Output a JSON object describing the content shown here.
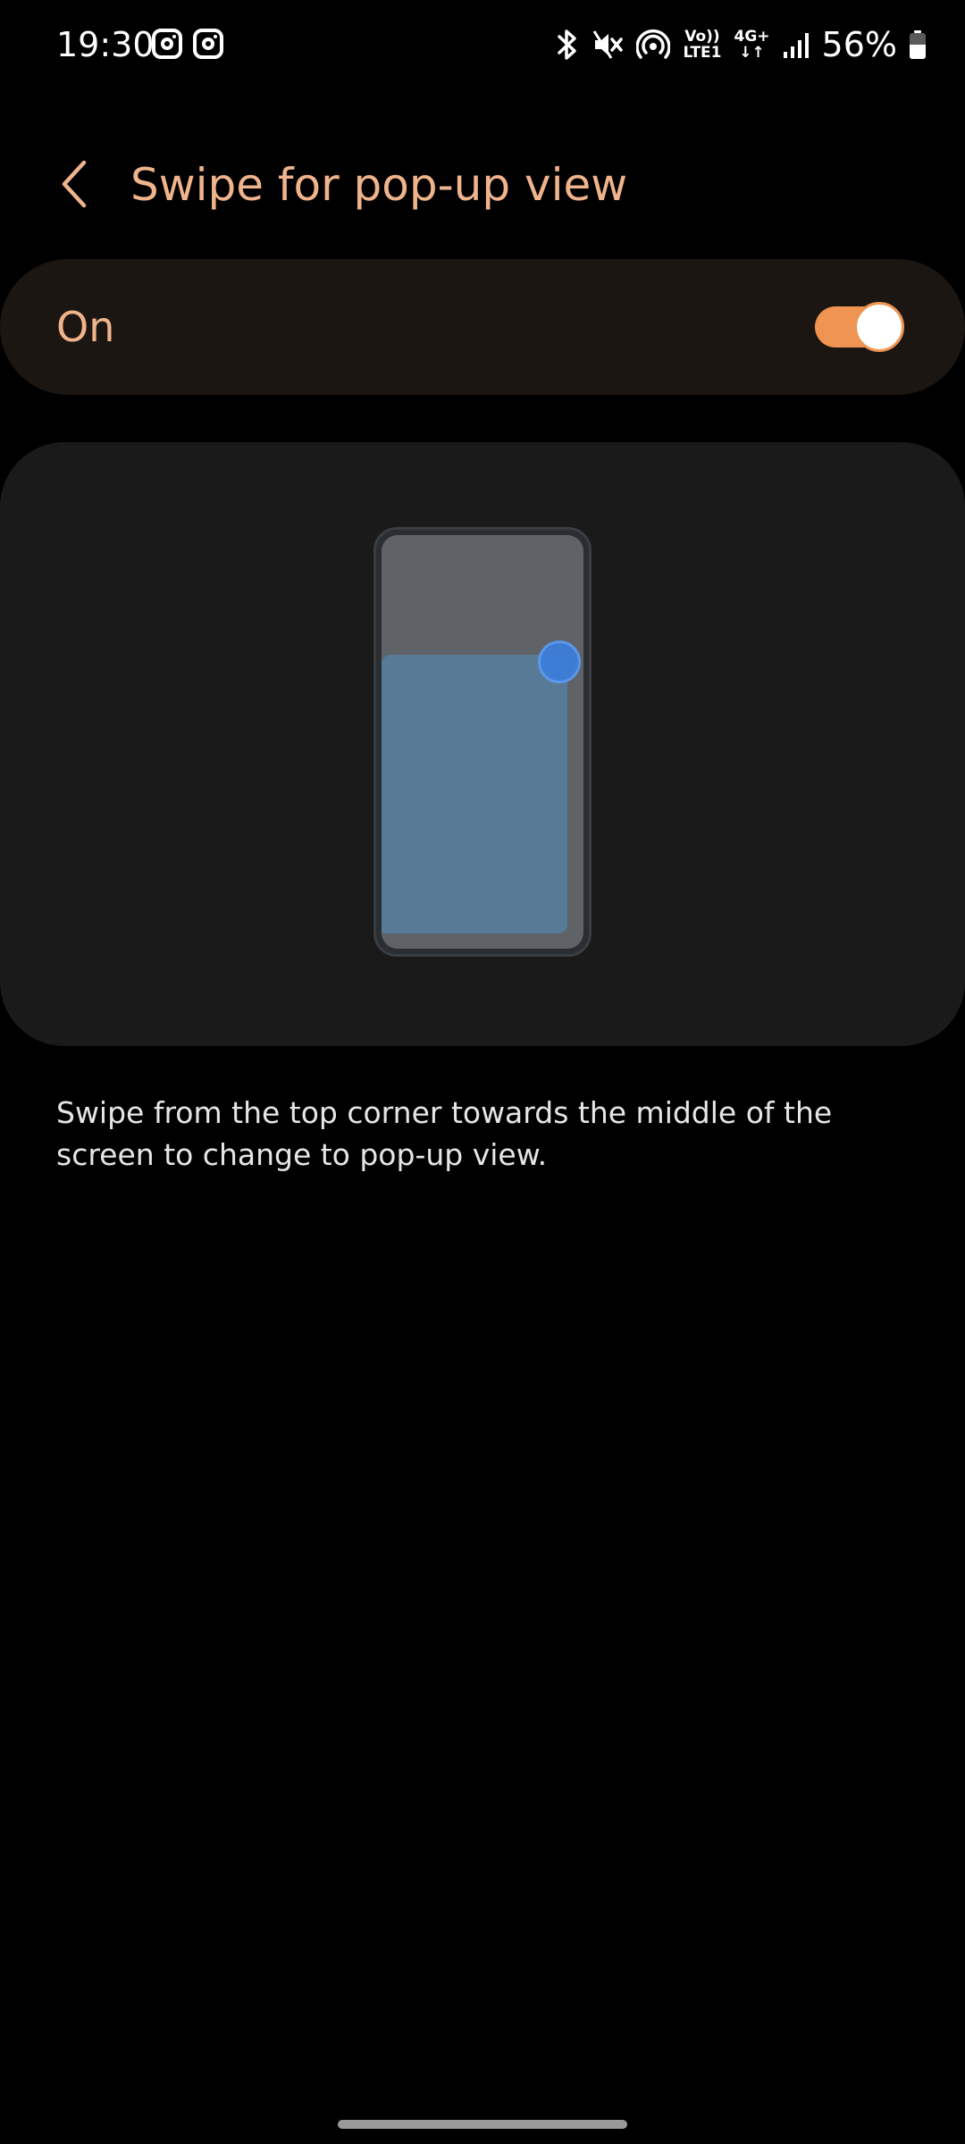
{
  "status_bar": {
    "time": "19:30",
    "left_icons": [
      "instagram-icon",
      "instagram-icon"
    ],
    "right_icons": [
      "bluetooth-icon",
      "mute-icon",
      "hotspot-icon",
      "volte-icon",
      "mobile-data-icon",
      "signal-icon"
    ],
    "volte_top": "Vo))",
    "volte_bottom": "LTE1",
    "data_label": "4G+",
    "battery_percent": "56%",
    "battery_level": 0.56
  },
  "header": {
    "back_icon": "chevron-left-icon",
    "title": "Swipe for pop-up view"
  },
  "toggle": {
    "label": "On",
    "state": true
  },
  "description": "Swipe from the top corner towards the middle of the screen to change to pop-up view.",
  "colors": {
    "accent": "#ef9453",
    "title_text": "#f0b48c",
    "toggle_card_bg": "#1c1612",
    "illustration_bg": "#1a1a1a",
    "popup_window": "#587a96",
    "touch_dot": "#3d7ed9"
  }
}
